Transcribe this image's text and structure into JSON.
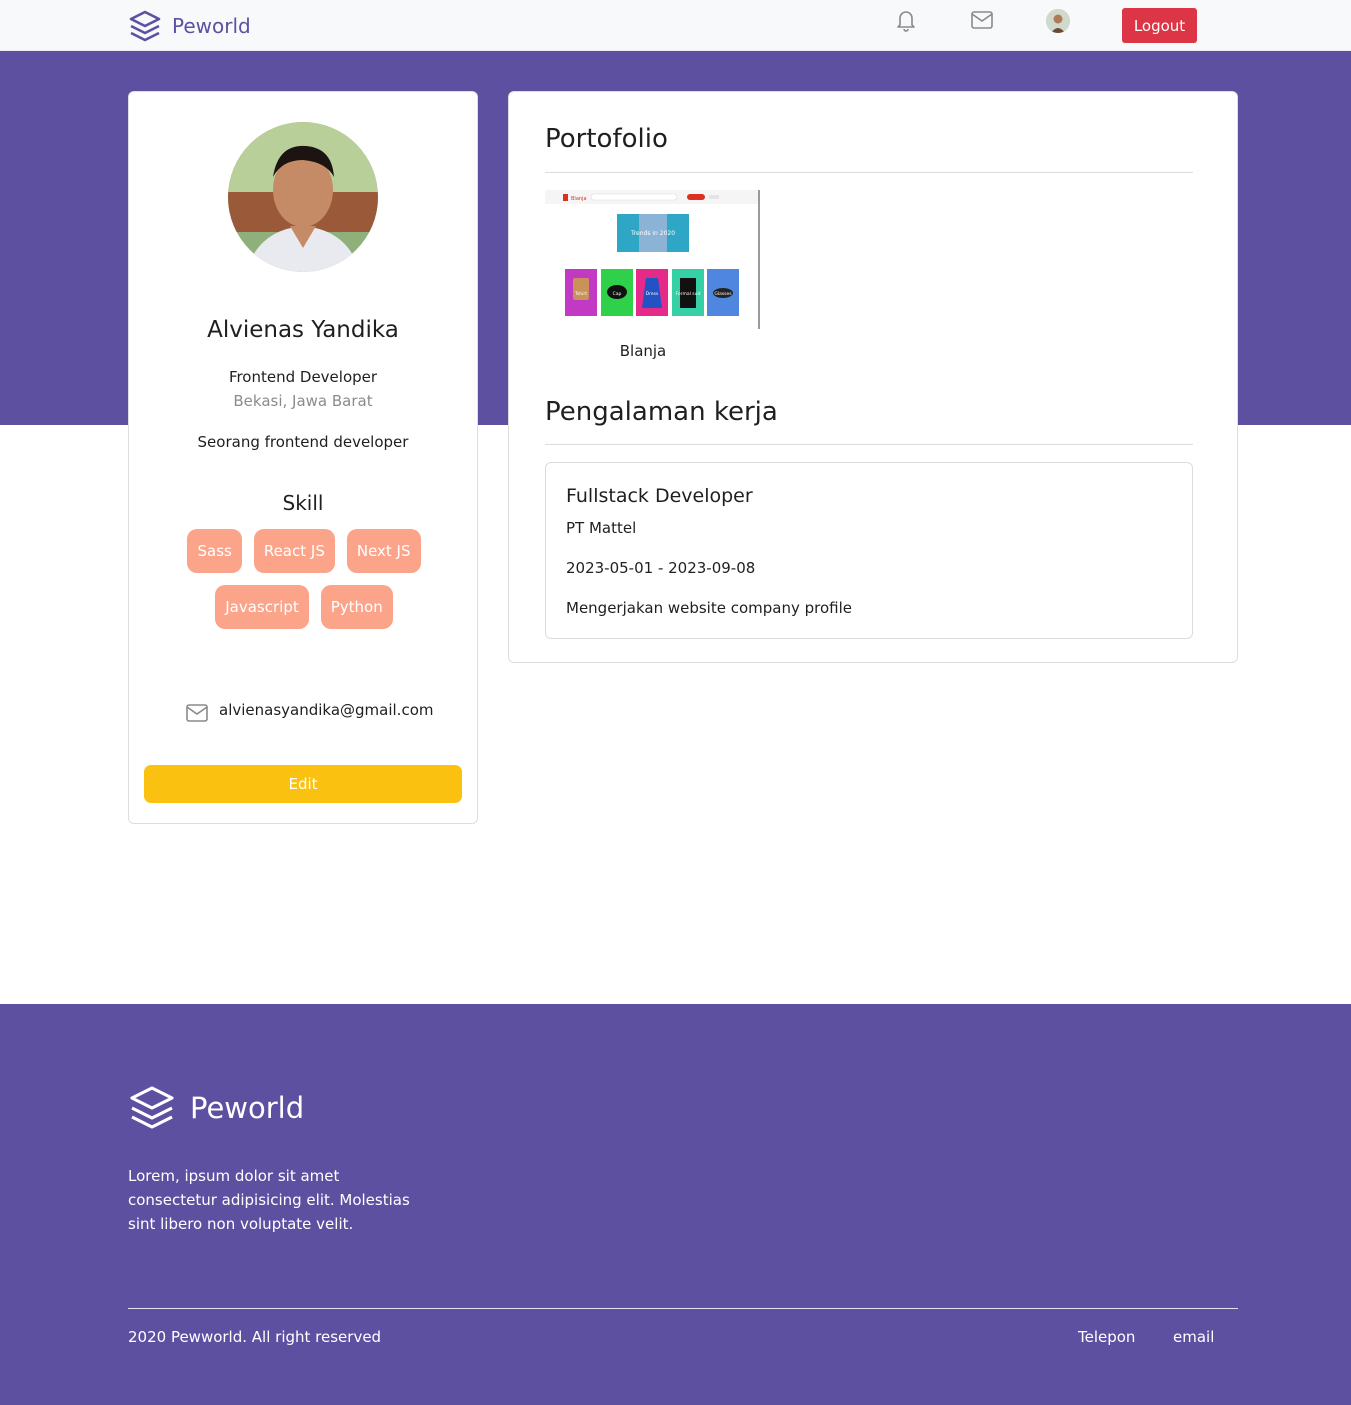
{
  "navbar": {
    "brand": "Peworld",
    "icons": [
      "bell-icon",
      "mail-icon"
    ],
    "logout_label": "Logout"
  },
  "profile": {
    "name": "Alvienas Yandika",
    "job": "Frontend Developer",
    "location": "Bekasi, Jawa Barat",
    "description": "Seorang frontend developer",
    "skill_title": "Skill",
    "skills": [
      "Sass",
      "React JS",
      "Next JS",
      "Javascript",
      "Python"
    ],
    "email": "alvienasyandika@gmail.com",
    "edit_label": "Edit"
  },
  "portfolio": {
    "title": "Portofolio",
    "items": [
      {
        "caption": "Blanja",
        "thumb": {
          "logo": "Blanja",
          "banner": "Trends in 2020",
          "categories": [
            "Tshirt",
            "Cap",
            "Dress",
            "Formal suit",
            "Glasses"
          ]
        }
      }
    ]
  },
  "experience": {
    "title": "Pengalaman kerja",
    "items": [
      {
        "role": "Fullstack Developer",
        "company": "PT Mattel",
        "dates": "2023-05-01 - 2023-09-08",
        "description": "Mengerjakan website company profile"
      }
    ]
  },
  "footer": {
    "brand": "Peworld",
    "text": "Lorem, ipsum dolor sit amet consectetur adipisicing elit. Molestias sint libero non voluptate velit.",
    "copyright": "2020 Pewworld. All right reserved",
    "links": [
      "Telepon",
      "email"
    ]
  },
  "colors": {
    "primary": "#5e50a1",
    "logout": "#dc3545",
    "skill_pill": "#fba48a",
    "edit_button": "#fbc110"
  }
}
